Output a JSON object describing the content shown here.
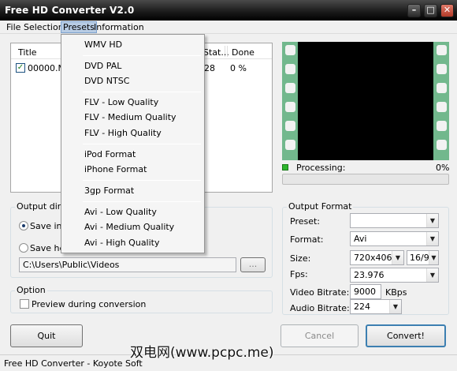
{
  "window": {
    "title": "Free HD Converter V2.0"
  },
  "menubar": {
    "items": [
      "File",
      "Selection",
      "Presets",
      "Information"
    ]
  },
  "file_list": {
    "columns": {
      "title": "Title",
      "status": "Stat...",
      "done": "Done"
    },
    "rows": [
      {
        "checked": true,
        "title": "00000.MT",
        "status": "28",
        "done": "0 %"
      }
    ]
  },
  "preview": {
    "progress_label": "Processing:",
    "progress_percent": "0%",
    "progress_value": 0
  },
  "presets_menu": {
    "groups": [
      [
        "WMV HD"
      ],
      [
        "DVD PAL",
        "DVD NTSC"
      ],
      [
        "FLV - Low Quality",
        "FLV - Medium Quality",
        "FLV - High Quality"
      ],
      [
        "iPod Format",
        "iPhone Format"
      ],
      [
        "3gp Format"
      ],
      [
        "Avi - Low Quality",
        "Avi - Medium Quality",
        "Avi - High Quality"
      ]
    ]
  },
  "output_directory": {
    "group_label": "Output direct",
    "option_save_in": "Save in t",
    "option_save_here": "Save her",
    "path": "C:\\Users\\Public\\Videos",
    "browse_label": "..."
  },
  "option": {
    "group_label": "Option",
    "preview_label": "Preview during conversion",
    "preview_checked": false
  },
  "output_format": {
    "group_label": "Output Format",
    "preset_label": "Preset:",
    "preset_value": "",
    "format_label": "Format:",
    "format_value": "Avi",
    "size_label": "Size:",
    "size_value": "720x406",
    "aspect_value": "16/9",
    "fps_label": "Fps:",
    "fps_value": "23.976",
    "video_bitrate_label": "Video Bitrate:",
    "video_bitrate_value": "9000",
    "video_bitrate_unit": "KBps",
    "audio_bitrate_label": "Audio Bitrate:",
    "audio_bitrate_value": "224"
  },
  "buttons": {
    "quit": "Quit",
    "cancel": "Cancel",
    "convert": "Convert!"
  },
  "status_bar": {
    "text": "Free HD Converter - Koyote Soft"
  },
  "watermark": {
    "text": "双电网(www.pcpc.me)"
  },
  "colors": {
    "film_strip": "#72b88d",
    "progress_fill": "#06b025",
    "menu_highlight": "#b8cce4"
  }
}
